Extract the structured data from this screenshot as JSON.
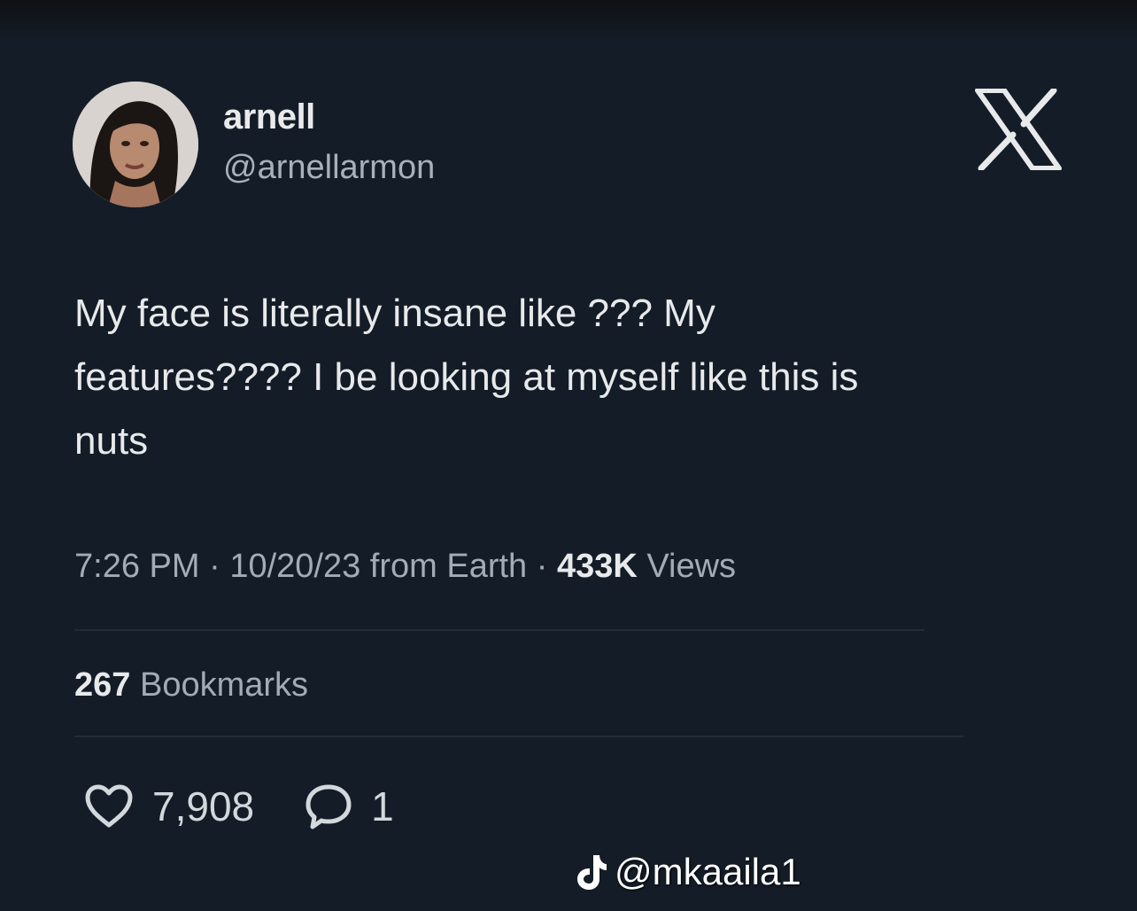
{
  "author": {
    "display_name": "arnell",
    "handle": "@arnellarmon"
  },
  "tweet": {
    "text": "My face is literally insane like ??? My\nfeatures???? I be looking at myself like this is\nnuts"
  },
  "meta": {
    "time": "7:26 PM",
    "date": "10/20/23",
    "source": "from Earth",
    "separator": "·",
    "views_count": "433K",
    "views_label": "Views"
  },
  "stats": {
    "bookmarks_count": "267",
    "bookmarks_label": "Bookmarks"
  },
  "actions": {
    "likes": "7,908",
    "replies": "1"
  },
  "icons": {
    "brand": "x-logo-icon",
    "like": "heart-icon",
    "reply": "speech-bubble-icon",
    "watermark": "tiktok-icon"
  },
  "watermark": {
    "text": "@mkaaila1"
  },
  "colors": {
    "background": "#131c27",
    "text_primary": "#e7e9ea",
    "text_secondary": "#a3acb5"
  }
}
